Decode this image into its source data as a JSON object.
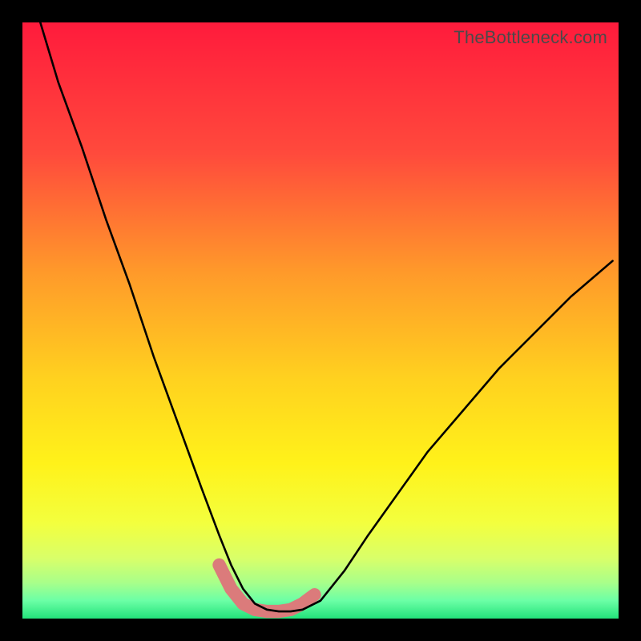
{
  "watermark": "TheBottleneck.com",
  "chart_data": {
    "type": "line",
    "title": "",
    "xlabel": "",
    "ylabel": "",
    "xlim": [
      0,
      100
    ],
    "ylim": [
      0,
      100
    ],
    "grid": false,
    "legend": false,
    "annotations": [],
    "series": [
      {
        "name": "bottleneck-curve",
        "color": "#000000",
        "x": [
          3,
          6,
          10,
          14,
          18,
          22,
          26,
          30,
          33,
          35,
          37,
          39,
          41,
          43,
          45,
          47,
          50,
          54,
          58,
          63,
          68,
          74,
          80,
          86,
          92,
          99
        ],
        "y": [
          100,
          90,
          79,
          67,
          56,
          44,
          33,
          22,
          14,
          9,
          5,
          2.5,
          1.5,
          1.2,
          1.2,
          1.5,
          3,
          8,
          14,
          21,
          28,
          35,
          42,
          48,
          54,
          60
        ]
      },
      {
        "name": "optimal-band",
        "color": "#db7b7b",
        "x": [
          33,
          35,
          37,
          39,
          41,
          43,
          45,
          47,
          49
        ],
        "y": [
          9,
          5,
          2.5,
          1.5,
          1.2,
          1.2,
          1.5,
          2.5,
          4
        ]
      }
    ],
    "background_gradient": {
      "stops": [
        {
          "offset": 0.0,
          "color": "#ff1b3c"
        },
        {
          "offset": 0.22,
          "color": "#ff4a3c"
        },
        {
          "offset": 0.42,
          "color": "#ff9a2a"
        },
        {
          "offset": 0.6,
          "color": "#ffd21f"
        },
        {
          "offset": 0.74,
          "color": "#fff21a"
        },
        {
          "offset": 0.84,
          "color": "#f3ff3e"
        },
        {
          "offset": 0.9,
          "color": "#d8ff6a"
        },
        {
          "offset": 0.94,
          "color": "#a8ff8a"
        },
        {
          "offset": 0.97,
          "color": "#6bffa6"
        },
        {
          "offset": 1.0,
          "color": "#23e27a"
        }
      ]
    }
  }
}
